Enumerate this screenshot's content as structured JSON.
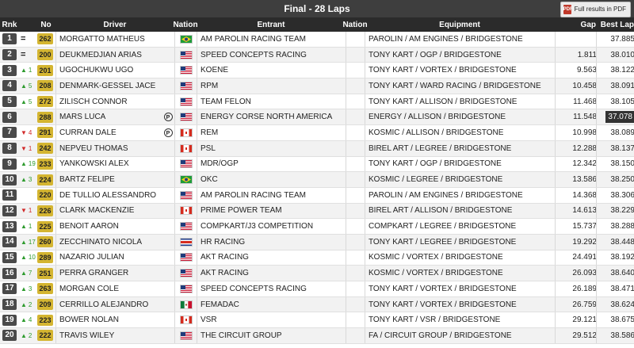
{
  "title": "Final - 28 Laps",
  "pdf_button": {
    "label": "Full results in PDF",
    "icon": "pdf-icon"
  },
  "columns": {
    "rnk": "Rnk",
    "no": "No",
    "driver": "Driver",
    "nation": "Nation",
    "entrant": "Entrant",
    "nation2": "Nation",
    "equipment": "Equipment",
    "gap": "Gap",
    "best": "Best Lap"
  },
  "rows": [
    {
      "rnk": "1",
      "move": "=",
      "dir": "eq",
      "no": "262",
      "driver": "MORGATTO MATHEUS",
      "pen": "",
      "flag": "BR",
      "entrant": "AM PAROLIN RACING TEAM",
      "equipment": "PAROLIN / AM ENGINES / BRIDGESTONE",
      "gap": "",
      "best": "37.885"
    },
    {
      "rnk": "2",
      "move": "=",
      "dir": "eq",
      "no": "200",
      "driver": "DEUKMEDJIAN ARIAS",
      "pen": "",
      "flag": "US",
      "entrant": "SPEED CONCEPTS RACING",
      "equipment": "TONY KART / OGP / BRIDGESTONE",
      "gap": "1.811",
      "best": "38.010"
    },
    {
      "rnk": "3",
      "move": "1",
      "dir": "up",
      "no": "201",
      "driver": "UGOCHUKWU UGO",
      "pen": "",
      "flag": "US",
      "entrant": "KOENE",
      "equipment": "TONY KART / VORTEX / BRIDGESTONE",
      "gap": "9.563",
      "best": "38.122"
    },
    {
      "rnk": "4",
      "move": "5",
      "dir": "up",
      "no": "208",
      "driver": "DENMARK-GESSEL JACE",
      "pen": "",
      "flag": "US",
      "entrant": "RPM",
      "equipment": "TONY KART / WARD RACING / BRIDGESTONE",
      "gap": "10.458",
      "best": "38.091"
    },
    {
      "rnk": "5",
      "move": "5",
      "dir": "up",
      "no": "272",
      "driver": "ZILISCH CONNOR",
      "pen": "",
      "flag": "US",
      "entrant": "TEAM FELON",
      "equipment": "TONY KART / ALLISON / BRIDGESTONE",
      "gap": "11.468",
      "best": "38.105"
    },
    {
      "rnk": "6",
      "move": "",
      "dir": "",
      "no": "288",
      "driver": "MARS LUCA",
      "pen": "P",
      "flag": "US",
      "entrant": "ENERGY CORSE NORTH AMERICA",
      "equipment": "ENERGY / ALLISON / BRIDGESTONE",
      "gap": "11.548",
      "best": "37.078",
      "highlight": true
    },
    {
      "rnk": "7",
      "move": "4",
      "dir": "down",
      "no": "291",
      "driver": "CURRAN DALE",
      "pen": "P",
      "flag": "CA",
      "entrant": "REM",
      "equipment": "KOSMIC / ALLISON / BRIDGESTONE",
      "gap": "10.998",
      "best": "38.089"
    },
    {
      "rnk": "8",
      "move": "1",
      "dir": "down",
      "no": "242",
      "driver": "NEPVEU THOMAS",
      "pen": "",
      "flag": "CA",
      "entrant": "PSL",
      "equipment": "BIREL ART / LEGREE / BRIDGESTONE",
      "gap": "12.288",
      "best": "38.137"
    },
    {
      "rnk": "9",
      "move": "19",
      "dir": "up",
      "no": "233",
      "driver": "YANKOWSKI ALEX",
      "pen": "",
      "flag": "US",
      "entrant": "MDR/OGP",
      "equipment": "TONY KART / OGP / BRIDGESTONE",
      "gap": "12.342",
      "best": "38.150"
    },
    {
      "rnk": "10",
      "move": "3",
      "dir": "up",
      "no": "224",
      "driver": "BARTZ FELIPE",
      "pen": "",
      "flag": "BR",
      "entrant": "OKC",
      "equipment": "KOSMIC / LEGREE / BRIDGESTONE",
      "gap": "13.586",
      "best": "38.250"
    },
    {
      "rnk": "11",
      "move": "",
      "dir": "",
      "no": "220",
      "driver": "DE TULLIO ALESSANDRO",
      "pen": "",
      "flag": "US",
      "entrant": "AM PAROLIN RACING TEAM",
      "equipment": "PAROLIN / AM ENGINES / BRIDGESTONE",
      "gap": "14.368",
      "best": "38.306"
    },
    {
      "rnk": "12",
      "move": "1",
      "dir": "down",
      "no": "226",
      "driver": "CLARK MACKENZIE",
      "pen": "",
      "flag": "CA",
      "entrant": "PRIME POWER TEAM",
      "equipment": "BIREL ART / ALLISON / BRIDGESTONE",
      "gap": "14.613",
      "best": "38.229"
    },
    {
      "rnk": "13",
      "move": "1",
      "dir": "up",
      "no": "225",
      "driver": "BENOIT AARON",
      "pen": "",
      "flag": "US",
      "entrant": "COMPKART/J3 COMPETITION",
      "equipment": "COMPKART / LEGREE / BRIDGESTONE",
      "gap": "15.737",
      "best": "38.288"
    },
    {
      "rnk": "14",
      "move": "17",
      "dir": "up",
      "no": "260",
      "driver": "ZECCHINATO NICOLA",
      "pen": "",
      "flag": "CR",
      "entrant": "HR RACING",
      "equipment": "TONY KART / LEGREE / BRIDGESTONE",
      "gap": "19.292",
      "best": "38.448"
    },
    {
      "rnk": "15",
      "move": "10",
      "dir": "up",
      "no": "289",
      "driver": "NAZARIO JULIAN",
      "pen": "",
      "flag": "US",
      "entrant": "AKT RACING",
      "equipment": "KOSMIC / VORTEX / BRIDGESTONE",
      "gap": "24.491",
      "best": "38.192"
    },
    {
      "rnk": "16",
      "move": "7",
      "dir": "up",
      "no": "251",
      "driver": "PERRA GRANGER",
      "pen": "",
      "flag": "US",
      "entrant": "AKT RACING",
      "equipment": "KOSMIC / VORTEX / BRIDGESTONE",
      "gap": "26.093",
      "best": "38.640"
    },
    {
      "rnk": "17",
      "move": "3",
      "dir": "up",
      "no": "263",
      "driver": "MORGAN COLE",
      "pen": "",
      "flag": "US",
      "entrant": "SPEED CONCEPTS RACING",
      "equipment": "TONY KART / VORTEX / BRIDGESTONE",
      "gap": "26.189",
      "best": "38.471"
    },
    {
      "rnk": "18",
      "move": "2",
      "dir": "up",
      "no": "209",
      "driver": "CERRILLO ALEJANDRO",
      "pen": "",
      "flag": "MX",
      "entrant": "FEMADAC",
      "equipment": "TONY KART / VORTEX / BRIDGESTONE",
      "gap": "26.759",
      "best": "38.624"
    },
    {
      "rnk": "19",
      "move": "4",
      "dir": "up",
      "no": "223",
      "driver": "BOWER NOLAN",
      "pen": "",
      "flag": "CA",
      "entrant": "VSR",
      "equipment": "TONY KART / VSR / BRIDGESTONE",
      "gap": "29.121",
      "best": "38.675"
    },
    {
      "rnk": "20",
      "move": "2",
      "dir": "up",
      "no": "222",
      "driver": "TRAVIS WILEY",
      "pen": "",
      "flag": "US",
      "entrant": "THE CIRCUIT GROUP",
      "equipment": "FA / CIRCUIT GROUP / BRIDGESTONE",
      "gap": "29.512",
      "best": "38.586"
    }
  ]
}
